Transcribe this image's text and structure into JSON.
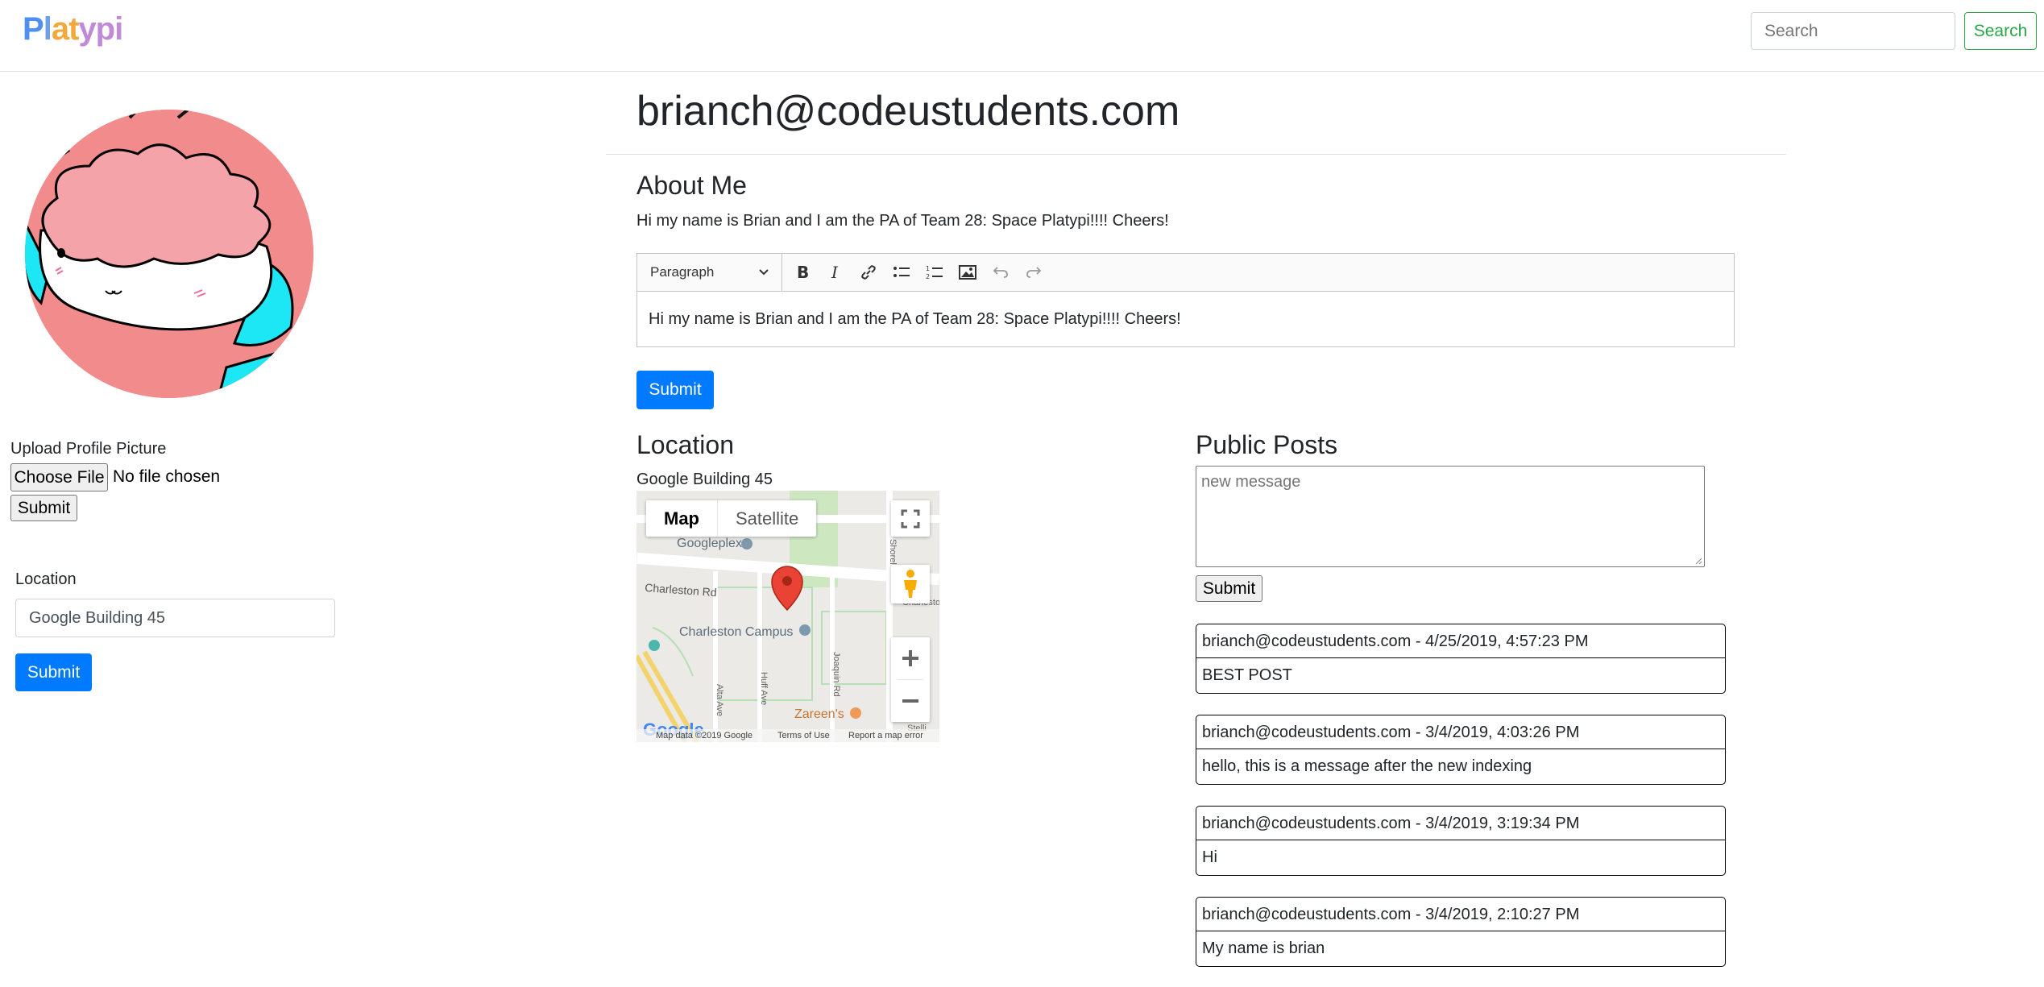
{
  "navbar": {
    "brand": [
      "P",
      "l",
      "a",
      "t",
      "y",
      "p",
      "i"
    ],
    "brand_colors": [
      "#4f8ff0",
      "#6fa0e8",
      "#f2a93b",
      "#f2a93b",
      "#c08ad8",
      "#c08ad8",
      "#c08ad8"
    ],
    "search_placeholder": "Search",
    "search_button": "Search"
  },
  "sidebar": {
    "upload_label": "Upload Profile Picture",
    "choose_file": "Choose File",
    "no_file": "No file chosen",
    "upload_submit": "Submit",
    "location_label": "Location",
    "location_value": "Google Building 45",
    "location_submit": "Submit"
  },
  "profile": {
    "email_title": "brianch@codeustudents.com",
    "about_heading": "About Me",
    "about_text": "Hi my name is Brian and I am the PA of Team 28: Space Platypi!!!! Cheers!",
    "editor": {
      "paragraph_select": "Paragraph",
      "content": "Hi my name is Brian and I am the PA of Team 28: Space Platypi!!!! Cheers!"
    },
    "about_submit": "Submit"
  },
  "location": {
    "heading": "Location",
    "place": "Google Building 45",
    "map": {
      "tab_map": "Map",
      "tab_satellite": "Satellite",
      "labels": [
        "Googleplex",
        "Charleston Rd",
        "Charleston Campus",
        "Alta Ave",
        "Huff Ave",
        "Joaquin Rd",
        "Shorel",
        "Zareen's",
        "Charlesto",
        "Stelli"
      ],
      "footer_data": "Map data ©2019 Google",
      "footer_terms": "Terms of Use",
      "footer_report": "Report a map error",
      "logo": "Google"
    }
  },
  "posts": {
    "heading": "Public Posts",
    "placeholder": "new message",
    "submit": "Submit",
    "items": [
      {
        "header": "brianch@codeustudents.com - 4/25/2019, 4:57:23 PM",
        "body": "BEST POST"
      },
      {
        "header": "brianch@codeustudents.com - 3/4/2019, 4:03:26 PM",
        "body": "hello, this is a message after the new indexing"
      },
      {
        "header": "brianch@codeustudents.com - 3/4/2019, 3:19:34 PM",
        "body": "Hi"
      },
      {
        "header": "brianch@codeustudents.com - 3/4/2019, 2:10:27 PM",
        "body": "My name is brian"
      }
    ]
  },
  "colors": {
    "primary": "#007bff",
    "success": "#28a745",
    "avatar_bg": "#f28b8b",
    "avatar_hair": "#f4a3a8",
    "avatar_accent": "#1de6f5",
    "map_pin": "#ea4335"
  }
}
